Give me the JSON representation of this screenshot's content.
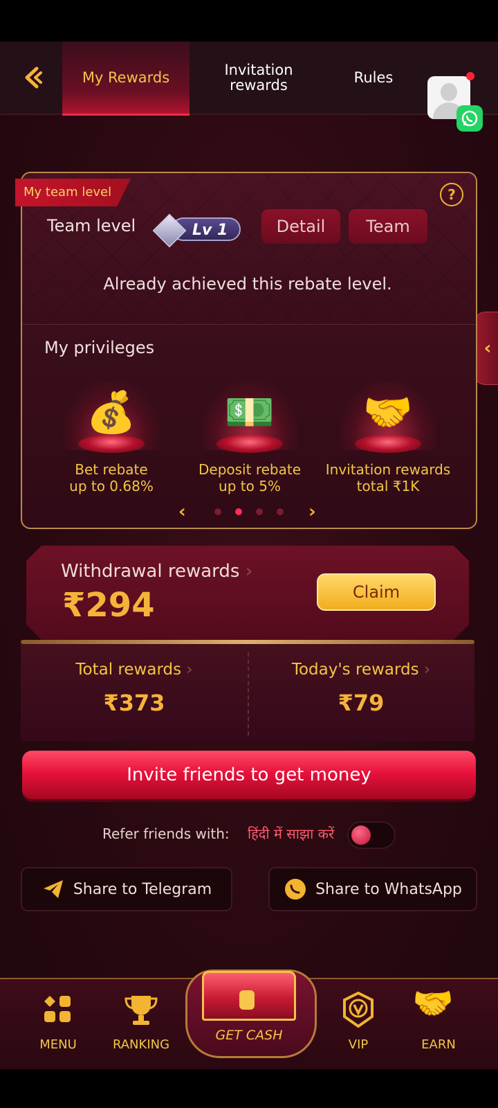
{
  "topnav": {
    "tabs": [
      {
        "label": "My Rewards"
      },
      {
        "label": "Invitation rewards"
      },
      {
        "label": "Rules"
      }
    ]
  },
  "team": {
    "ribbon": "My team level",
    "level_label": "Team level",
    "level_badge": "Lv 1",
    "detail_button": "Detail",
    "team_button": "Team",
    "status_text": "Already achieved this rebate level.",
    "privileges_title": "My privileges",
    "privileges": [
      {
        "line1": "Bet rebate",
        "line2": "up to 0.68%",
        "icon": "coins-gems-icon"
      },
      {
        "line1": "Deposit rebate",
        "line2": "up to 5%",
        "icon": "money-chest-icon"
      },
      {
        "line1": "Invitation rewards",
        "line2": "total ₹1K",
        "icon": "handshake-icon"
      }
    ],
    "pager": {
      "total": 4,
      "active_index": 1
    }
  },
  "withdrawal": {
    "label": "Withdrawal rewards",
    "amount": "₹294",
    "claim_button": "Claim"
  },
  "stats": {
    "total_label": "Total rewards",
    "total_value": "₹373",
    "today_label": "Today's rewards",
    "today_value": "₹79"
  },
  "invite": {
    "button": "Invite friends to get money",
    "refer_label": "Refer friends with:",
    "refer_hindi": "हिंदी में साझा करें",
    "share_telegram": "Share to Telegram",
    "share_whatsapp": "Share to WhatsApp"
  },
  "bottomnav": {
    "menu": "MENU",
    "ranking": "RANKING",
    "get_cash": "GET CASH",
    "vip": "VIP",
    "earn": "EARN"
  },
  "colors": {
    "accent_gold": "#f2c646",
    "accent_red": "#e8123c",
    "background": "#2a0911"
  }
}
